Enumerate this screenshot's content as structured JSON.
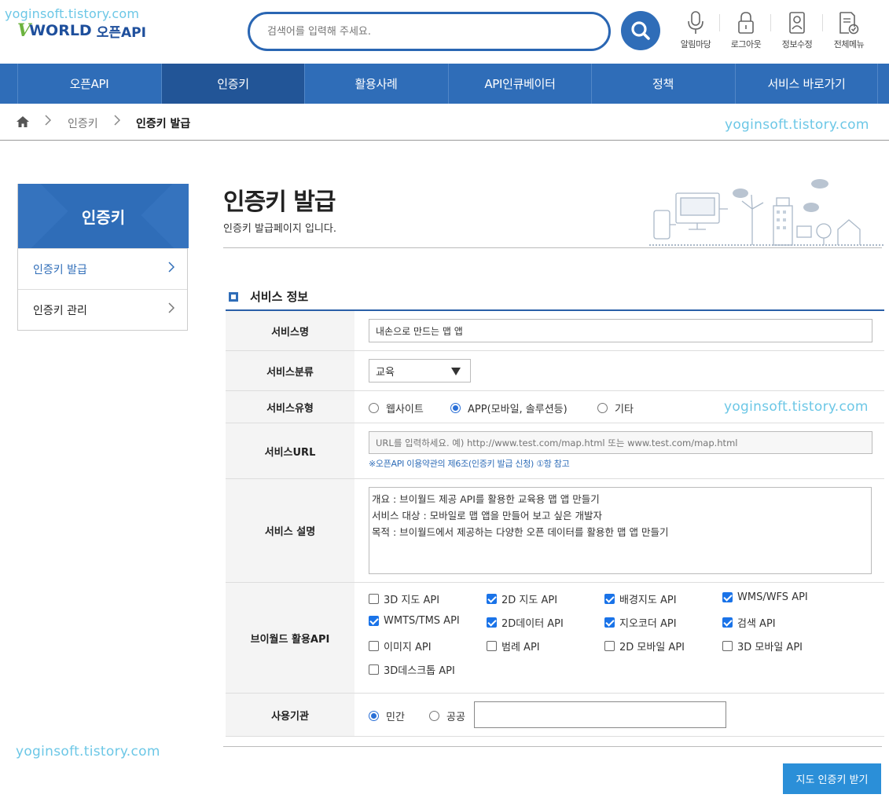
{
  "watermark": "yoginsoft.tistory.com",
  "logo": {
    "v": "V",
    "world": "WORLD",
    "open": "오픈API"
  },
  "search": {
    "placeholder": "검색어를 입력해 주세요."
  },
  "util": [
    {
      "label": "알림마당",
      "icon": "microphone-icon"
    },
    {
      "label": "로그아웃",
      "icon": "lock-icon"
    },
    {
      "label": "정보수정",
      "icon": "user-card-icon"
    },
    {
      "label": "전체메뉴",
      "icon": "document-check-icon"
    }
  ],
  "nav": {
    "items": [
      "오픈API",
      "인증키",
      "활용사례",
      "API인큐베이터",
      "정책",
      "서비스 바로가기"
    ],
    "active": 1
  },
  "breadcrumb": {
    "level1": "인증키",
    "level2": "인증키 발급"
  },
  "side": {
    "title": "인증키",
    "items": [
      {
        "label": "인증키 발급",
        "active": true
      },
      {
        "label": "인증키 관리",
        "active": false
      }
    ]
  },
  "page": {
    "title": "인증키 발급",
    "subtitle": "인증키 발급페이지 입니다."
  },
  "section": {
    "title": "서비스 정보"
  },
  "form": {
    "service_name": {
      "label": "서비스명",
      "value": "내손으로 만드는 맵 앱"
    },
    "service_category": {
      "label": "서비스분류",
      "value": "교육"
    },
    "service_type": {
      "label": "서비스유형",
      "options": [
        "웹사이트",
        "APP(모바일, 솔루션등)",
        "기타"
      ],
      "selected": 1
    },
    "service_url": {
      "label": "서비스URL",
      "placeholder": "URL를 입력하세요. 예) http://www.test.com/map.html 또는 www.test.com/map.html",
      "note": "※오픈API 이용약관의 제6조(인증키 발급 신청) ①항 참고"
    },
    "service_desc": {
      "label": "서비스 설명",
      "value": "개요 : 브이월드 제공 API를 활용한 교육용 맵 앱 만들기\n서비스 대상 : 모바일로 맵 앱을 만들어 보고 싶은 개발자\n목적 : 브이월드에서 제공하는 다양한 오픈 데이터를 활용한 맵 앱 만들기"
    },
    "apis": {
      "label": "브이월드 활용API",
      "items": [
        {
          "label": "3D 지도 API",
          "checked": false
        },
        {
          "label": "2D 지도 API",
          "checked": true
        },
        {
          "label": "배경지도 API",
          "checked": true
        },
        {
          "label": "WMS/WFS API",
          "checked": true
        },
        {
          "label": "WMTS/TMS API",
          "checked": true
        },
        {
          "label": "2D데이터 API",
          "checked": true
        },
        {
          "label": "지오코더 API",
          "checked": true
        },
        {
          "label": "검색 API",
          "checked": true
        },
        {
          "label": "이미지 API",
          "checked": false
        },
        {
          "label": "범례 API",
          "checked": false
        },
        {
          "label": "2D 모바일 API",
          "checked": false
        },
        {
          "label": "3D 모바일 API",
          "checked": false
        },
        {
          "label": "3D데스크톱 API",
          "checked": false
        }
      ]
    },
    "org": {
      "label": "사용기관",
      "options": [
        "민간",
        "공공"
      ],
      "selected": 0,
      "value": ""
    }
  },
  "submit_label": "지도 인증키 받기"
}
